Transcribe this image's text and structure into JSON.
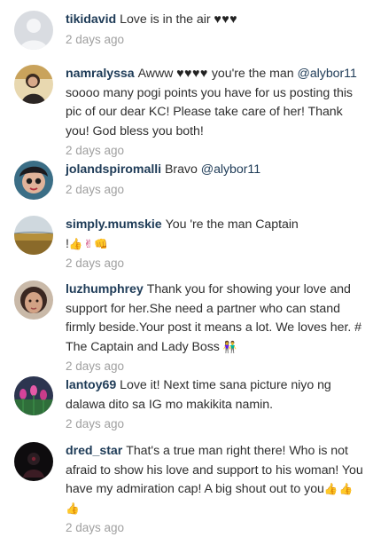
{
  "comments": [
    {
      "username": "tikidavid",
      "text": "Love is in the air",
      "trailing": "♥♥♥",
      "time": "2 days ago",
      "avatar": "default-avatar"
    },
    {
      "username": "namralyssa",
      "text_pre": "Awww",
      "hearts": "♥♥♥♥",
      "text_mid": "you're the man",
      "mention": "@alybor11",
      "text_post": "soooo many pogi points you have for us posting this pic of our dear KC! Please take care of her! Thank you! God bless you both!",
      "time": "2 days ago",
      "avatar": "woman-portrait-avatar"
    },
    {
      "username": "jolandspiromalli",
      "text": "Bravo",
      "mention": "@alybor11",
      "time": "2 days ago",
      "avatar": "selfie-avatar"
    },
    {
      "username": "simply.mumskie",
      "text": "You 're the man Captain",
      "line2": "!",
      "emojis": "👍✌👊",
      "time": "2 days ago",
      "avatar": "flower-field-avatar"
    },
    {
      "username": "luzhumphrey",
      "text": "Thank you for showing your love and support for her.She need a partner who can stand firmly beside.Your post it means a lot. We loves her. # The Captain and Lady Boss",
      "emojis": "👫",
      "time": "2 days ago",
      "avatar": "woman-face-avatar"
    },
    {
      "username": "lantoy69",
      "text": "Love it! Next time sana picture niyo ng dalawa dito sa IG mo makikita namin.",
      "time": "2 days ago",
      "avatar": "tulips-avatar"
    },
    {
      "username": "dred_star",
      "text": "That's a true man right there! Who is not afraid to show his love and support to his woman! You have my admiration cap! A big shout out to you",
      "emojis": "👍👍👍",
      "time": "2 days ago",
      "avatar": "dark-silhouette-avatar"
    }
  ],
  "colors": {
    "username": "#1e3b57",
    "body_text": "#2f2f2f",
    "timestamp": "#a0a0a0",
    "emoji": "#c2185b"
  }
}
